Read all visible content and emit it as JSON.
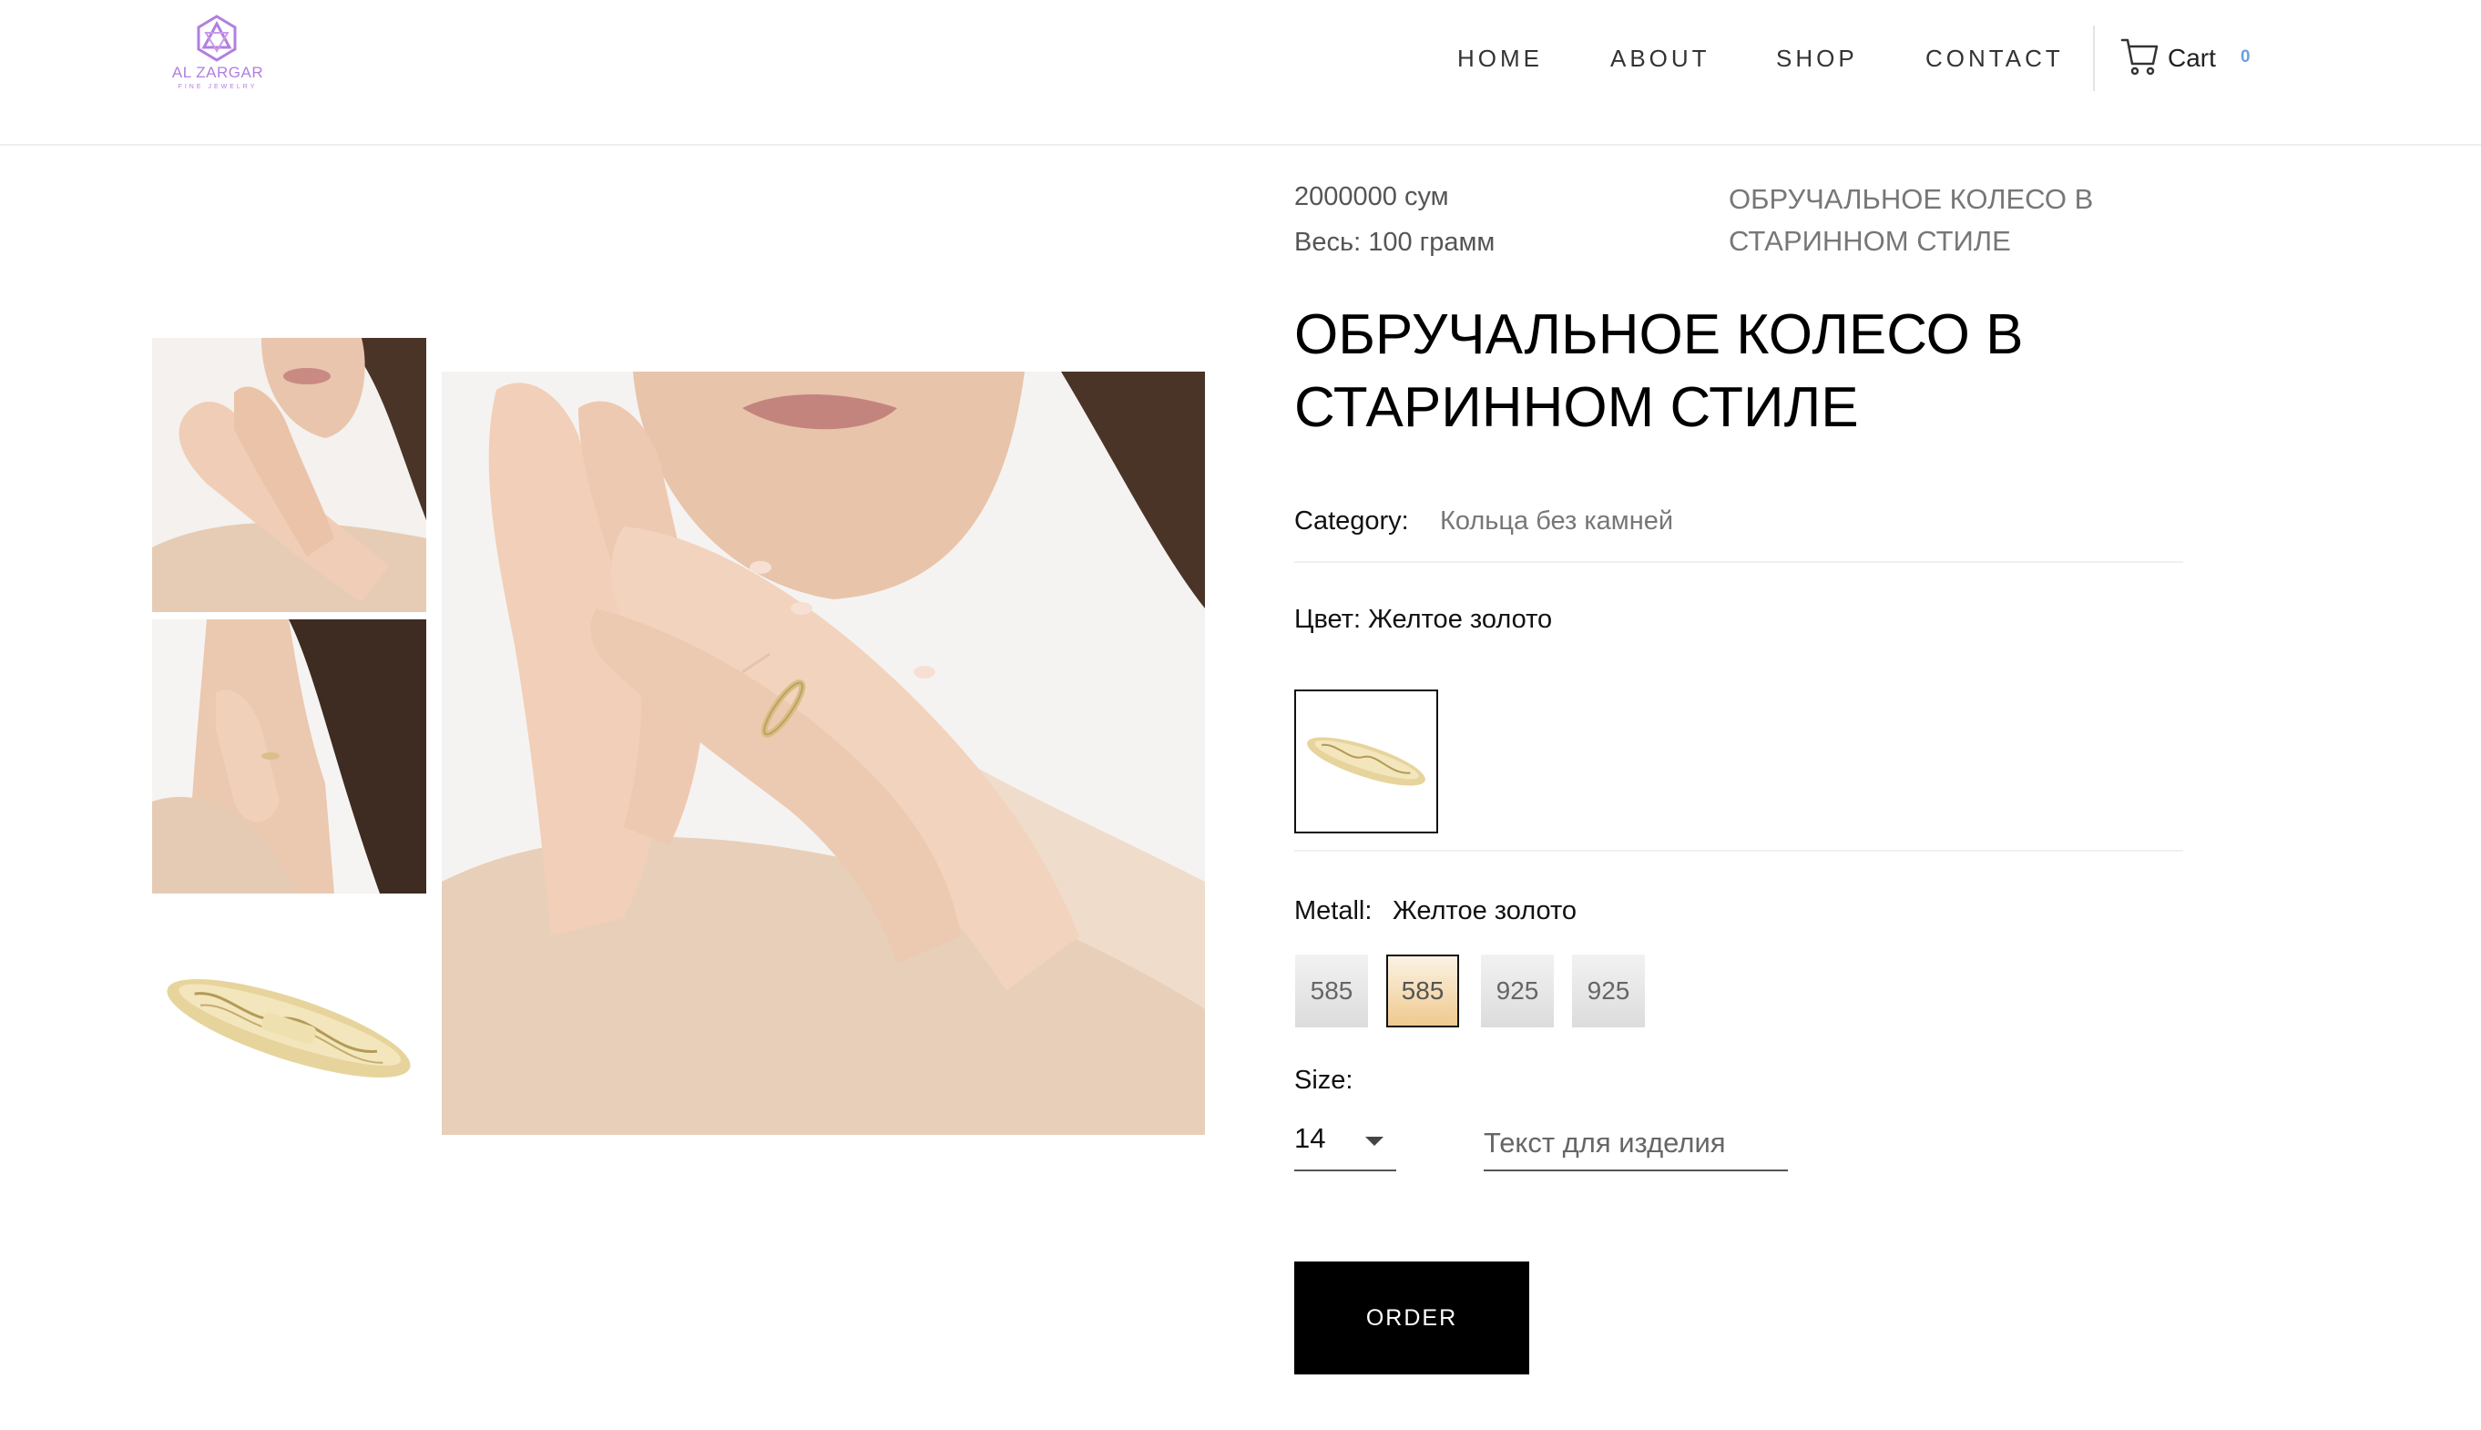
{
  "brand": {
    "name": "AL ZARGAR",
    "tagline": "FINE JEWELRY",
    "accent_color": "#b07fe0"
  },
  "nav": {
    "items": [
      {
        "label": "HOME"
      },
      {
        "label": "ABOUT"
      },
      {
        "label": "SHOP"
      },
      {
        "label": "CONTACT"
      }
    ],
    "cart_label": "Cart",
    "cart_count": "0",
    "cart_icon": "cart-icon"
  },
  "gallery": {
    "thumbnails": [
      {
        "name": "model-hands-on-face"
      },
      {
        "name": "model-hand-near-ear"
      },
      {
        "name": "gold-engraved-ring"
      }
    ],
    "main_image": "model-hands-on-face"
  },
  "product": {
    "price": "2000000 сум",
    "weight": "Весь: 100 грамм",
    "breadcrumb": "ОБРУЧАЛЬНОЕ КОЛЕСО В СТАРИННОМ СТИЛЕ",
    "title": "ОБРУЧАЛЬНОЕ КОЛЕСО В СТАРИННОМ СТИЛЕ",
    "category_label": "Category:",
    "category_value": "Кольца без камней",
    "color_label": "Цвет: Желтое золото",
    "metall_label": "Metall:",
    "metall_value": "Желтое золото",
    "metal_options": [
      {
        "label": "585",
        "selected": false
      },
      {
        "label": "585",
        "selected": true
      },
      {
        "label": "925",
        "selected": false
      },
      {
        "label": "925",
        "selected": false
      }
    ],
    "size_label": "Size:",
    "size_value": "14",
    "engraving_placeholder": "Текст для изделия",
    "order_label": "ORDER"
  }
}
